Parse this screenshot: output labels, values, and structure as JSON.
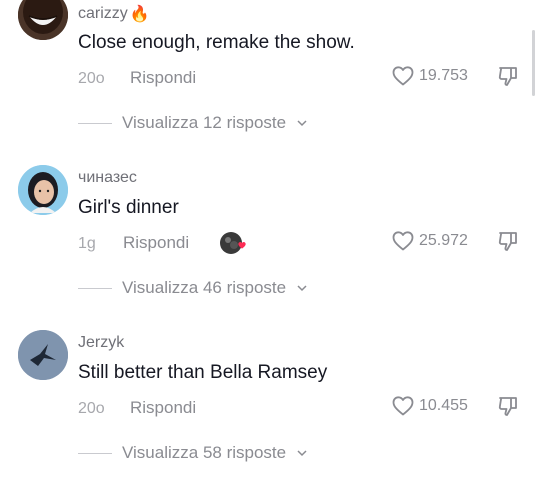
{
  "comments": [
    {
      "username": "carizzy",
      "username_emoji": "🔥",
      "text": "Close enough, remake the show.",
      "time": "20o",
      "reply_label": "Rispondi",
      "likes": "19.753",
      "view_replies": "Visualizza 12 risposte"
    },
    {
      "username": "чиназес",
      "text": "Girl's dinner",
      "time": "1g",
      "reply_label": "Rispondi",
      "likes": "25.972",
      "view_replies": "Visualizza 46 risposte"
    },
    {
      "username": "Jerzyk",
      "text": "Still better than Bella Ramsey",
      "time": "20o",
      "reply_label": "Rispondi",
      "likes": "10.455",
      "view_replies": "Visualizza 58 risposte"
    }
  ],
  "icons": {
    "like": "heart-outline-icon",
    "dislike": "thumb-down-icon",
    "chevron": "chevron-down-icon"
  },
  "colors": {
    "text": "#161823",
    "secondary": "#8a8b91",
    "heart_badge": "#fe2c55"
  }
}
